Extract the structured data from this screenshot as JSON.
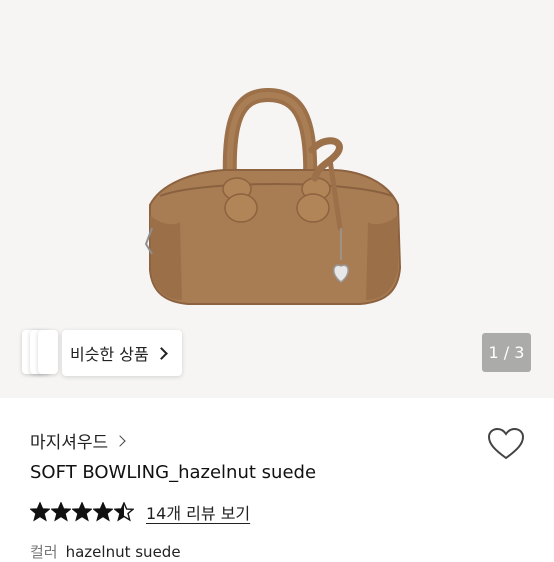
{
  "product_image": {
    "alt": "hazelnut suede bowling bag"
  },
  "similar_products": {
    "label": "비슷한 상품"
  },
  "image_pager": {
    "text": "1 / 3"
  },
  "brand": {
    "name": "마지셔우드"
  },
  "product": {
    "title": "SOFT BOWLING_hazelnut suede"
  },
  "rating": {
    "stars": 4.5,
    "max_stars": 5,
    "review_link": "14개 리뷰 보기"
  },
  "option": {
    "label": "컬러",
    "value": "hazelnut suede"
  },
  "colors": {
    "bag": "#a97d53",
    "star": "#111111"
  }
}
